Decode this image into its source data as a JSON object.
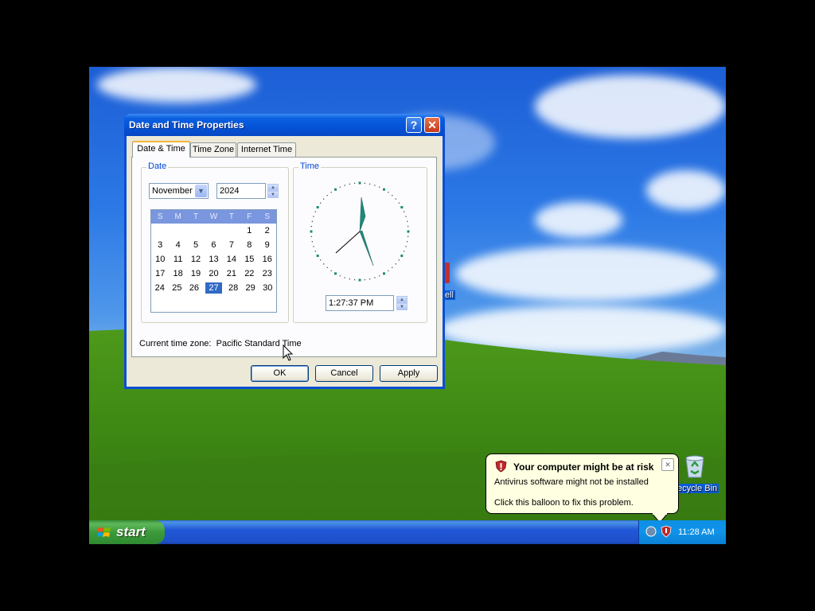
{
  "dialog": {
    "title": "Date and Time Properties",
    "help_label": "?",
    "close_label": "✕",
    "tabs": [
      {
        "label": "Date & Time",
        "active": true
      },
      {
        "label": "Time Zone",
        "active": false
      },
      {
        "label": "Internet Time",
        "active": false
      }
    ],
    "date_group_label": "Date",
    "time_group_label": "Time",
    "month_value": "November",
    "year_value": "2024",
    "calendar": {
      "weekdays": [
        "S",
        "M",
        "T",
        "W",
        "T",
        "F",
        "S"
      ],
      "weeks": [
        [
          "",
          "",
          "",
          "",
          "",
          "1",
          "2"
        ],
        [
          "3",
          "4",
          "5",
          "6",
          "7",
          "8",
          "9"
        ],
        [
          "10",
          "11",
          "12",
          "13",
          "14",
          "15",
          "16"
        ],
        [
          "17",
          "18",
          "19",
          "20",
          "21",
          "22",
          "23"
        ],
        [
          "24",
          "25",
          "26",
          "27",
          "28",
          "29",
          "30"
        ]
      ],
      "selected_day": "27"
    },
    "time_value": "1:27:37 PM",
    "timezone_label": "Current time zone:",
    "timezone_value": "Pacific Standard Time",
    "buttons": {
      "ok": "OK",
      "cancel": "Cancel",
      "apply": "Apply"
    }
  },
  "desktop": {
    "partial_icon_label": "ell",
    "recycle_bin_label": "ecycle Bin"
  },
  "taskbar": {
    "start_label": "start",
    "clock": "11:28 AM"
  },
  "balloon": {
    "title": "Your computer might be at risk",
    "line1": "Antivirus software might not be installed",
    "line2": "Click this balloon to fix this problem.",
    "close_label": "✕"
  },
  "icons": [
    "windows-logo-icon",
    "shield-warning-icon",
    "recycle-bin-icon",
    "mouse-cursor-icon"
  ]
}
